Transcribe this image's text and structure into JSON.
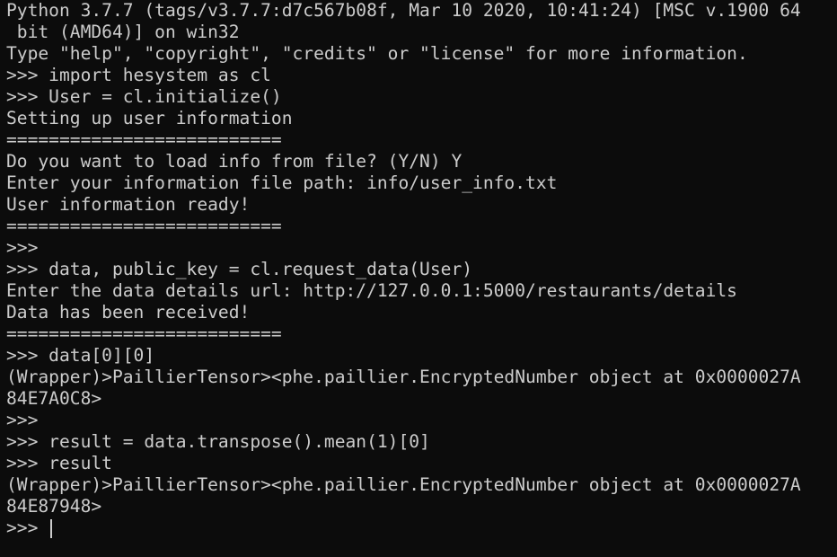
{
  "terminal": {
    "lines": [
      "Python 3.7.7 (tags/v3.7.7:d7c567b08f, Mar 10 2020, 10:41:24) [MSC v.1900 64",
      " bit (AMD64)] on win32",
      "Type \"help\", \"copyright\", \"credits\" or \"license\" for more information.",
      ">>> import hesystem as cl",
      ">>> User = cl.initialize()",
      "Setting up user information",
      "==========================",
      "Do you want to load info from file? (Y/N) Y",
      "Enter your information file path: info/user_info.txt",
      "User information ready!",
      "==========================",
      ">>>",
      ">>> data, public_key = cl.request_data(User)",
      "Enter the data details url: http://127.0.0.1:5000/restaurants/details",
      "Data has been received!",
      "==========================",
      ">>> data[0][0]",
      "(Wrapper)>PaillierTensor><phe.paillier.EncryptedNumber object at 0x0000027A",
      "84E7A0C8>",
      ">>>",
      ">>> result = data.transpose().mean(1)[0]",
      ">>> result",
      "(Wrapper)>PaillierTensor><phe.paillier.EncryptedNumber object at 0x0000027A",
      "84E87948>"
    ],
    "prompt": ">>> ",
    "colors": {
      "background": "#0c0c0c",
      "foreground": "#cccccc"
    }
  }
}
